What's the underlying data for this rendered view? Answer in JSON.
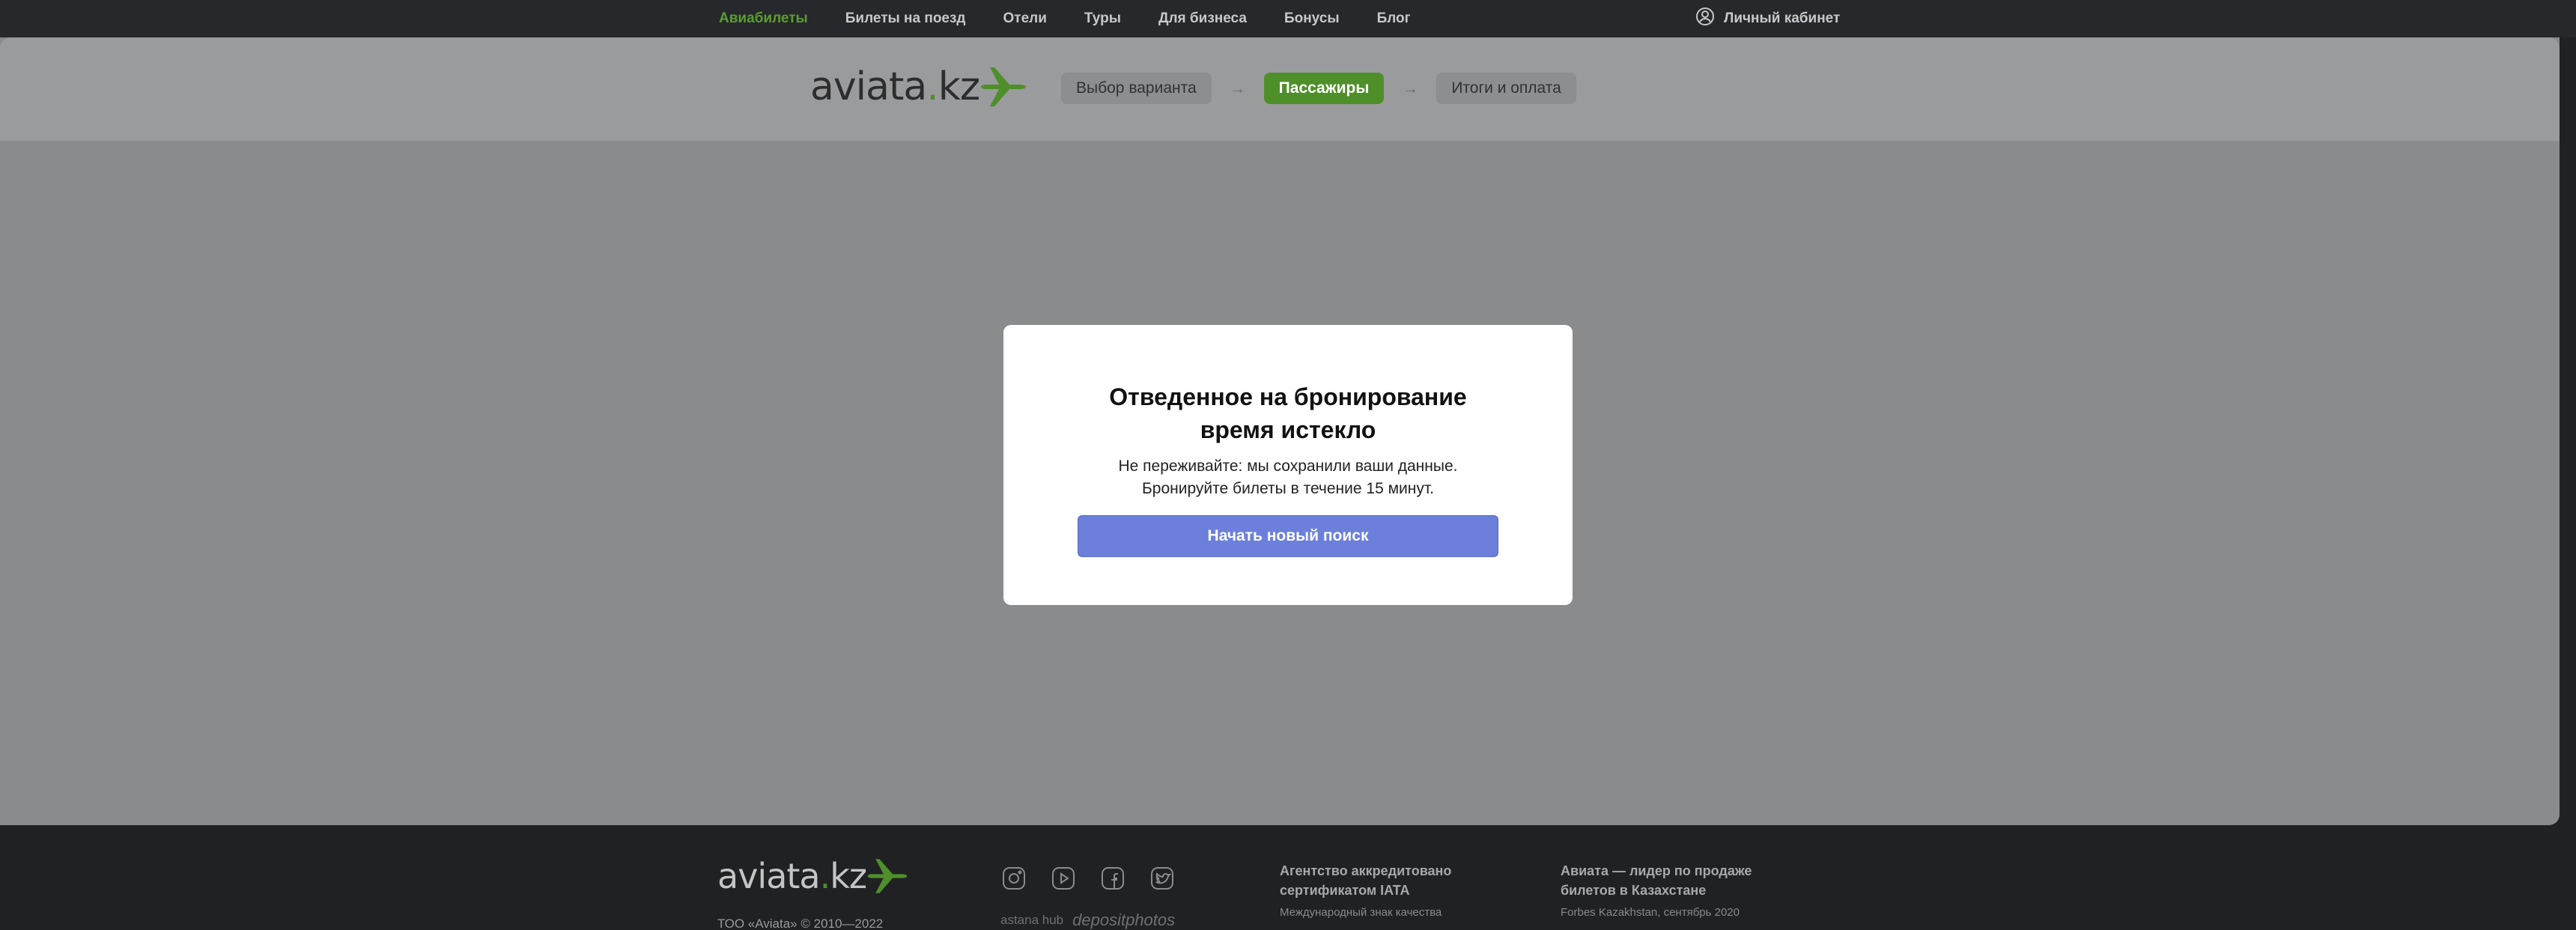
{
  "topnav": {
    "items": [
      "Авиабилеты",
      "Билеты на поезд",
      "Отели",
      "Туры",
      "Для бизнеса",
      "Бонусы",
      "Блог"
    ],
    "account_label": "Личный кабинет"
  },
  "brand": {
    "name_main": "aviata",
    "name_dot": ".",
    "name_tld": "kz",
    "accent_color": "#4f8f2a"
  },
  "steps": {
    "items": [
      "Выбор варианта",
      "Пассажиры",
      "Итоги и оплата"
    ],
    "current": "Пассажиры",
    "separator": "→"
  },
  "modal": {
    "title": "Отведенное на бронирование время истекло",
    "message_line1": "Не переживайте: мы сохранили ваши данные.",
    "message_line2": "Бронируйте билеты в течение 15 минут.",
    "button_label": "Начать новый поиск",
    "button_color": "#6c7fdb"
  },
  "footer": {
    "copyright": "ТОО «Aviata» © 2010—2022",
    "social_icons": [
      "instagram-icon",
      "youtube-icon",
      "facebook-icon",
      "twitter-icon"
    ],
    "partners": [
      "astana hub",
      "depositphotos"
    ],
    "col1_title": "Агентство аккредитовано сертификатом IATA",
    "col1_sub": "Международный знак качества",
    "col2_title": "Авиата — лидер по продаже билетов в Казахстане",
    "col2_sub": "Forbes Kazakhstan, сентябрь 2020"
  }
}
